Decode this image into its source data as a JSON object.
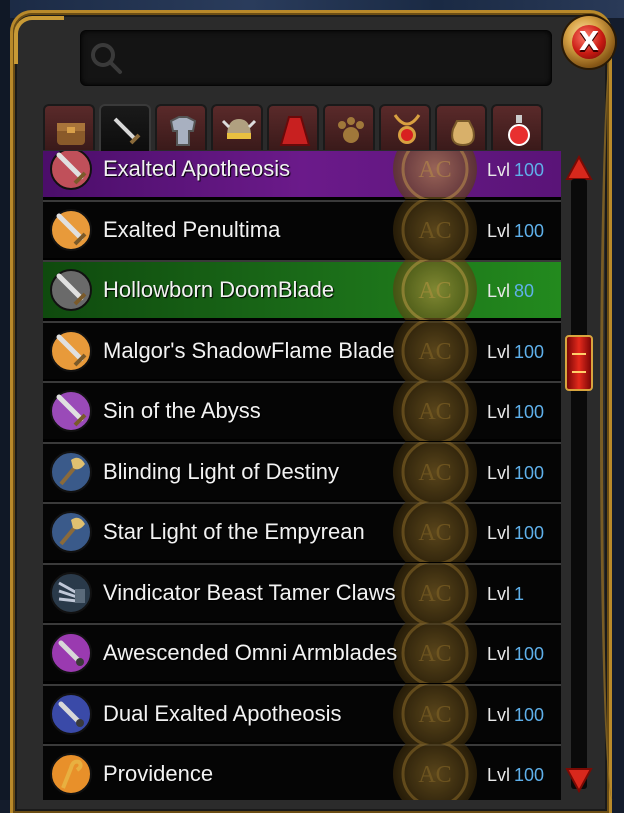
{
  "search": {
    "placeholder": ""
  },
  "close_button": {
    "label": "X"
  },
  "tabs": [
    {
      "icon": "bag-icon",
      "active": false
    },
    {
      "icon": "sword-icon",
      "active": true
    },
    {
      "icon": "armor-icon",
      "active": false
    },
    {
      "icon": "helmet-icon",
      "active": false
    },
    {
      "icon": "cape-icon",
      "active": false
    },
    {
      "icon": "pet-paw-icon",
      "active": false
    },
    {
      "icon": "amulet-icon",
      "active": false
    },
    {
      "icon": "item-sack-icon",
      "active": false
    },
    {
      "icon": "potion-icon",
      "active": false
    }
  ],
  "items": [
    {
      "name": "Exalted Apotheosis",
      "lvl_label": "Lvl",
      "level": "100",
      "rarity": "epic",
      "icon": "sword-icon",
      "icon_color": "#c0505a"
    },
    {
      "name": "Exalted Penultima",
      "lvl_label": "Lvl",
      "level": "100",
      "rarity": "normal",
      "icon": "sword-icon",
      "icon_color": "#e89a3a"
    },
    {
      "name": "Hollowborn DoomBlade",
      "lvl_label": "Lvl",
      "level": "80",
      "rarity": "rare",
      "icon": "sword-icon",
      "icon_color": "#6a6a6a"
    },
    {
      "name": "Malgor's ShadowFlame Blade",
      "lvl_label": "Lvl",
      "level": "100",
      "rarity": "normal",
      "icon": "sword-icon",
      "icon_color": "#e89a3a"
    },
    {
      "name": "Sin of the Abyss",
      "lvl_label": "Lvl",
      "level": "100",
      "rarity": "normal",
      "icon": "sword-icon",
      "icon_color": "#9a4ab8"
    },
    {
      "name": "Blinding Light of Destiny",
      "lvl_label": "Lvl",
      "level": "100",
      "rarity": "normal",
      "icon": "axe-icon",
      "icon_color": "#3a5a8a"
    },
    {
      "name": "Star Light of the Empyrean",
      "lvl_label": "Lvl",
      "level": "100",
      "rarity": "normal",
      "icon": "axe-icon",
      "icon_color": "#3a5a8a"
    },
    {
      "name": "Vindicator Beast Tamer Claws",
      "lvl_label": "Lvl",
      "level": "1",
      "rarity": "normal",
      "icon": "claw-icon",
      "icon_color": "#2a3a4a"
    },
    {
      "name": "Awescended Omni Armblades",
      "lvl_label": "Lvl",
      "level": "100",
      "rarity": "normal",
      "icon": "dagger-icon",
      "icon_color": "#9a3ab0"
    },
    {
      "name": "Dual Exalted Apotheosis",
      "lvl_label": "Lvl",
      "level": "100",
      "rarity": "normal",
      "icon": "dagger-icon",
      "icon_color": "#3a4aa8"
    },
    {
      "name": "Providence",
      "lvl_label": "Lvl",
      "level": "100",
      "rarity": "normal",
      "icon": "staff-icon",
      "icon_color": "#e8902a"
    }
  ],
  "scroll": {
    "position": 0.28
  },
  "colors": {
    "gold": "#b8892a",
    "epic": "#6b1a8a",
    "rare": "#1a6a18",
    "level_number": "#5fb0ea"
  }
}
